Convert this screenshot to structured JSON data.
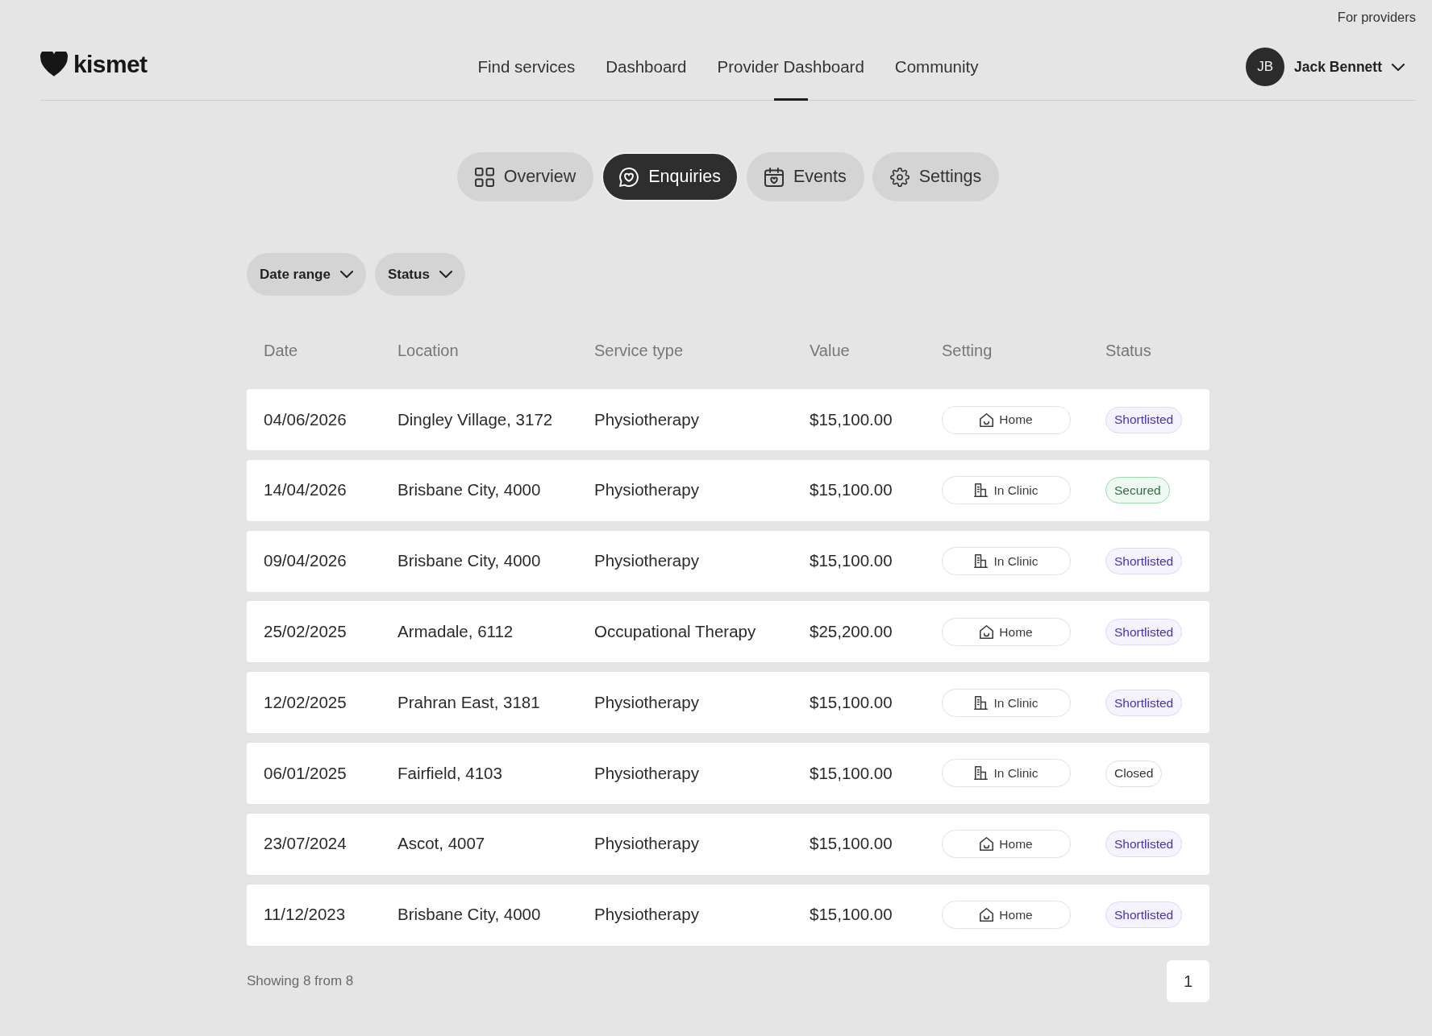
{
  "top_link": "For providers",
  "header": {
    "logo": "kismet",
    "nav": [
      {
        "label": "Find services",
        "selected": false
      },
      {
        "label": "Dashboard",
        "selected": false
      },
      {
        "label": "Provider Dashboard",
        "selected": true
      },
      {
        "label": "Community",
        "selected": false
      }
    ],
    "user": {
      "initials": "JB",
      "name": "Jack Bennett"
    }
  },
  "tabs": [
    {
      "label": "Overview",
      "selected": false
    },
    {
      "label": "Enquiries",
      "selected": true
    },
    {
      "label": "Events",
      "selected": false
    },
    {
      "label": "Settings",
      "selected": false
    }
  ],
  "filters": [
    "Date range",
    "Status"
  ],
  "table": {
    "columns": [
      "Date",
      "Location",
      "Service type",
      "Value",
      "Setting",
      "Status"
    ],
    "rows": [
      {
        "date": "04/06/2026",
        "location": "Dingley Village, 3172",
        "service_type": "Physiotherapy",
        "value": "$15,100.00",
        "setting": {
          "label": "Home",
          "kind": "home"
        },
        "status": {
          "label": "Shortlisted",
          "kind": "shortlisted"
        }
      },
      {
        "date": "14/04/2026",
        "location": "Brisbane City, 4000",
        "service_type": "Physiotherapy",
        "value": "$15,100.00",
        "setting": {
          "label": "In Clinic",
          "kind": "clinic"
        },
        "status": {
          "label": "Secured",
          "kind": "secured"
        }
      },
      {
        "date": "09/04/2026",
        "location": "Brisbane City, 4000",
        "service_type": "Physiotherapy",
        "value": "$15,100.00",
        "setting": {
          "label": "In Clinic",
          "kind": "clinic"
        },
        "status": {
          "label": "Shortlisted",
          "kind": "shortlisted"
        }
      },
      {
        "date": "25/02/2025",
        "location": "Armadale, 6112",
        "service_type": "Occupational Therapy",
        "value": "$25,200.00",
        "setting": {
          "label": "Home",
          "kind": "home"
        },
        "status": {
          "label": "Shortlisted",
          "kind": "shortlisted"
        }
      },
      {
        "date": "12/02/2025",
        "location": "Prahran East, 3181",
        "service_type": "Physiotherapy",
        "value": "$15,100.00",
        "setting": {
          "label": "In Clinic",
          "kind": "clinic"
        },
        "status": {
          "label": "Shortlisted",
          "kind": "shortlisted"
        }
      },
      {
        "date": "06/01/2025",
        "location": "Fairfield, 4103",
        "service_type": "Physiotherapy",
        "value": "$15,100.00",
        "setting": {
          "label": "In Clinic",
          "kind": "clinic"
        },
        "status": {
          "label": "Closed",
          "kind": "closed"
        }
      },
      {
        "date": "23/07/2024",
        "location": "Ascot, 4007",
        "service_type": "Physiotherapy",
        "value": "$15,100.00",
        "setting": {
          "label": "Home",
          "kind": "home"
        },
        "status": {
          "label": "Shortlisted",
          "kind": "shortlisted"
        }
      },
      {
        "date": "11/12/2023",
        "location": "Brisbane City, 4000",
        "service_type": "Physiotherapy",
        "value": "$15,100.00",
        "setting": {
          "label": "Home",
          "kind": "home"
        },
        "status": {
          "label": "Shortlisted",
          "kind": "shortlisted"
        }
      }
    ]
  },
  "footer": {
    "summary": "Showing 8 from 8",
    "pages": [
      {
        "label": "1",
        "selected": true
      }
    ]
  }
}
